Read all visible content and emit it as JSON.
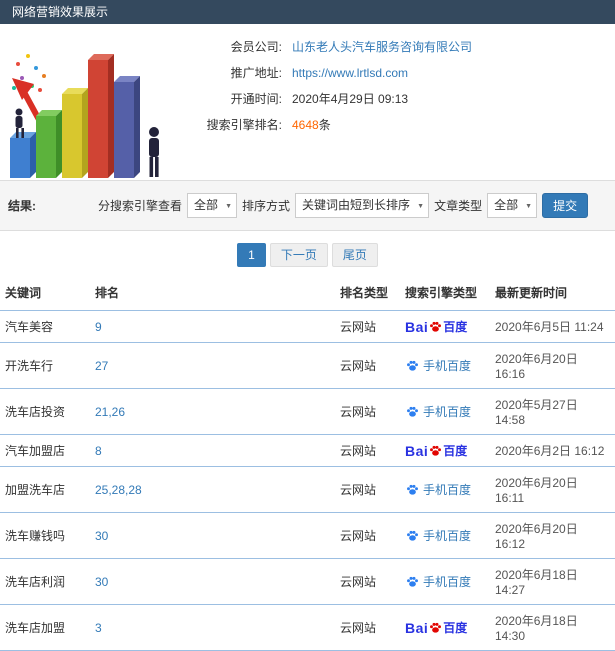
{
  "header": {
    "title": "网络营销效果展示"
  },
  "info": {
    "company_label": "会员公司:",
    "company_value": "山东老人头汽车服务咨询有限公司",
    "url_label": "推广地址:",
    "url_value": "https://www.lrtlsd.com",
    "open_label": "开通时间:",
    "open_value": "2020年4月29日 09:13",
    "rank_label": "搜索引擎排名:",
    "rank_value": "4648",
    "rank_suffix": "条"
  },
  "filters": {
    "result_label": "结果:",
    "engine_label": "分搜索引擎查看",
    "engine_value": "全部",
    "sort_label": "排序方式",
    "sort_value": "关键词由短到长排序",
    "article_label": "文章类型",
    "article_value": "全部",
    "submit_label": "提交"
  },
  "pagination": {
    "current": "1",
    "next_label": "下一页",
    "last_label": "尾页"
  },
  "table": {
    "headers": [
      "关键词",
      "排名",
      "排名类型",
      "搜索引擎类型",
      "最新更新时间"
    ],
    "engines": {
      "baidu": {
        "prefix": "Bai",
        "suffix": "百度"
      },
      "mobile": {
        "label": "手机百度"
      }
    },
    "rows": [
      {
        "keyword": "汽车美容",
        "rank": "9",
        "rank_type": "云网站",
        "engine": "baidu",
        "time": "2020年6月5日 11:24"
      },
      {
        "keyword": "开洗车行",
        "rank": "27",
        "rank_type": "云网站",
        "engine": "mobile",
        "time": "2020年6月20日 16:16"
      },
      {
        "keyword": "洗车店投资",
        "rank": "21,26",
        "rank_type": "云网站",
        "engine": "mobile",
        "time": "2020年5月27日 14:58"
      },
      {
        "keyword": "汽车加盟店",
        "rank": "8",
        "rank_type": "云网站",
        "engine": "baidu",
        "time": "2020年6月2日 16:12"
      },
      {
        "keyword": "加盟洗车店",
        "rank": "25,28,28",
        "rank_type": "云网站",
        "engine": "mobile",
        "time": "2020年6月20日 16:11"
      },
      {
        "keyword": "洗车赚钱吗",
        "rank": "30",
        "rank_type": "云网站",
        "engine": "mobile",
        "time": "2020年6月20日 16:12"
      },
      {
        "keyword": "洗车店利润",
        "rank": "30",
        "rank_type": "云网站",
        "engine": "mobile",
        "time": "2020年6月18日 14:27"
      },
      {
        "keyword": "洗车店加盟",
        "rank": "3",
        "rank_type": "云网站",
        "engine": "baidu",
        "time": "2020年6月18日 14:30"
      }
    ]
  },
  "colors": {
    "topbar": "#34495e",
    "accent_blue": "#337ab7",
    "highlight_orange": "#ff6600",
    "baidu_blue": "#2932e1",
    "baidu_red": "#e10602",
    "row_border": "#9cbfe2"
  }
}
